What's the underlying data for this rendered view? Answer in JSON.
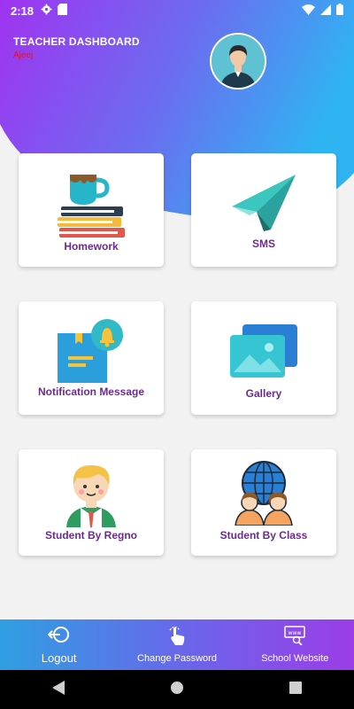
{
  "status_bar": {
    "time": "2:18"
  },
  "header": {
    "title": "TEACHER DASHBOARD",
    "subtitle": "Ajeej"
  },
  "tiles": [
    {
      "label": "Homework",
      "icon": "homework-books-cup-icon"
    },
    {
      "label": "SMS",
      "icon": "paper-plane-icon"
    },
    {
      "label": "Notification Message",
      "icon": "notification-bell-icon"
    },
    {
      "label": "Gallery",
      "icon": "gallery-images-icon"
    },
    {
      "label": "Student By Regno",
      "icon": "student-avatar-icon"
    },
    {
      "label": "Student By Class",
      "icon": "students-globe-icon"
    }
  ],
  "bottom_nav": [
    {
      "label": "Logout",
      "icon": "logout-icon"
    },
    {
      "label": "Change Password",
      "icon": "tap-hand-icon"
    },
    {
      "label": "School Website",
      "icon": "www-search-icon"
    }
  ],
  "colors": {
    "header_gradient_start": "#a033f0",
    "header_gradient_end": "#2fb4f2",
    "tile_label": "#6a2b8f",
    "subtitle": "#e0102a"
  }
}
